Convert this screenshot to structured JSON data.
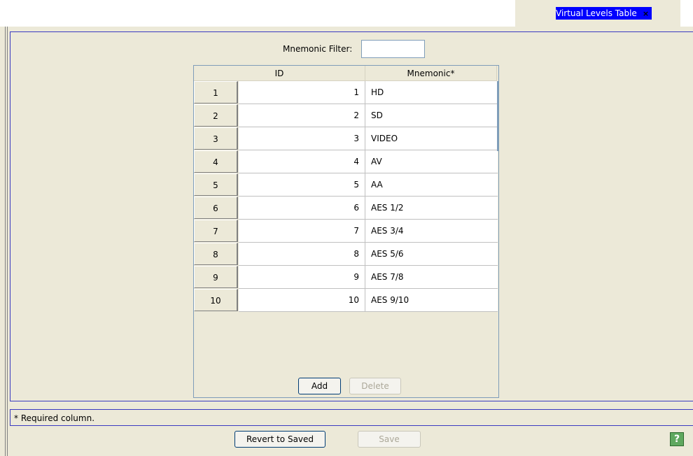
{
  "tab": {
    "title": "Virtual Levels Table",
    "close": "×"
  },
  "filter": {
    "label": "Mnemonic Filter:",
    "value": "",
    "placeholder": ""
  },
  "table": {
    "columns": [
      "ID",
      "Mnemonic*"
    ],
    "rows": [
      {
        "num": "1",
        "id": "1",
        "mnemonic": "HD"
      },
      {
        "num": "2",
        "id": "2",
        "mnemonic": "SD"
      },
      {
        "num": "3",
        "id": "3",
        "mnemonic": "VIDEO"
      },
      {
        "num": "4",
        "id": "4",
        "mnemonic": "AV"
      },
      {
        "num": "5",
        "id": "5",
        "mnemonic": "AA"
      },
      {
        "num": "6",
        "id": "6",
        "mnemonic": "AES 1/2"
      },
      {
        "num": "7",
        "id": "7",
        "mnemonic": "AES 3/4"
      },
      {
        "num": "8",
        "id": "8",
        "mnemonic": "AES 5/6"
      },
      {
        "num": "9",
        "id": "9",
        "mnemonic": "AES 7/8"
      },
      {
        "num": "10",
        "id": "10",
        "mnemonic": "AES 9/10"
      }
    ]
  },
  "buttons": {
    "add": "Add",
    "delete": "Delete",
    "revert": "Revert to Saved",
    "save": "Save",
    "help": "?"
  },
  "hint": "* Required column.",
  "colors": {
    "accent": "#0000ff",
    "background": "#ece9d8",
    "help": "#5fa85f"
  },
  "icons": {
    "close": "close-icon",
    "help": "help-icon"
  }
}
